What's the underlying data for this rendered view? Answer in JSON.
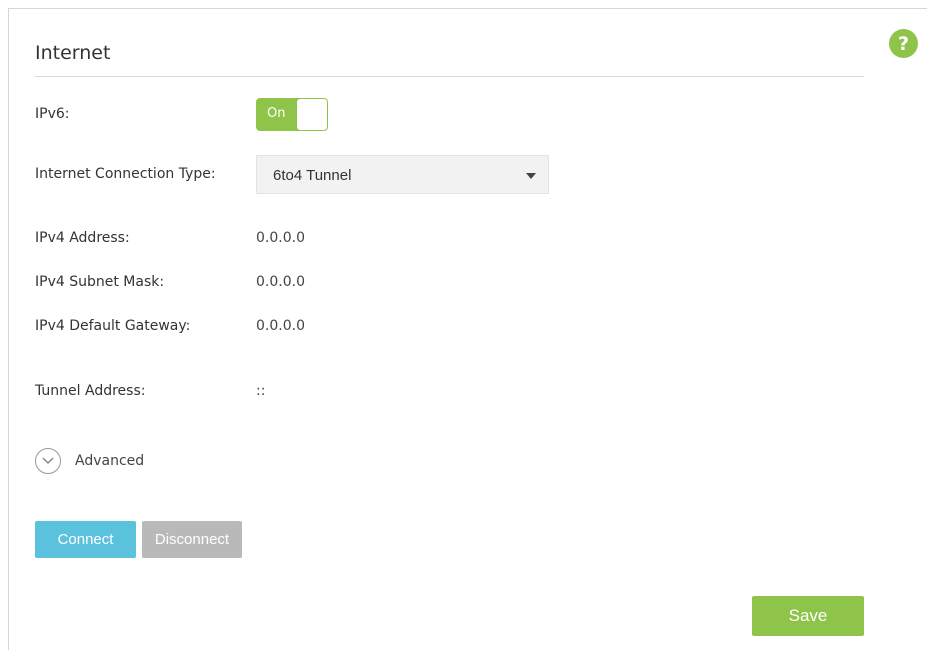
{
  "page": {
    "title": "Internet",
    "help_symbol": "?"
  },
  "ipv6": {
    "label": "IPv6:",
    "toggle_text": "On",
    "enabled": true
  },
  "connection_type": {
    "label": "Internet Connection Type:",
    "selected": "6to4 Tunnel"
  },
  "fields": {
    "ipv4_address": {
      "label": "IPv4 Address:",
      "value": "0.0.0.0"
    },
    "ipv4_subnet_mask": {
      "label": "IPv4 Subnet Mask:",
      "value": "0.0.0.0"
    },
    "ipv4_default_gateway": {
      "label": "IPv4 Default Gateway:",
      "value": "0.0.0.0"
    },
    "tunnel_address": {
      "label": "Tunnel Address:",
      "value": "::"
    }
  },
  "advanced": {
    "label": "Advanced"
  },
  "buttons": {
    "connect": "Connect",
    "disconnect": "Disconnect",
    "save": "Save"
  },
  "colors": {
    "accent_green": "#8ec44a",
    "connect_blue": "#5bc2de",
    "disabled_gray": "#b9b9b9"
  },
  "icons": {
    "help": "help-icon",
    "advanced": "chevron-down-circle-icon",
    "dropdown": "caret-down-icon"
  }
}
